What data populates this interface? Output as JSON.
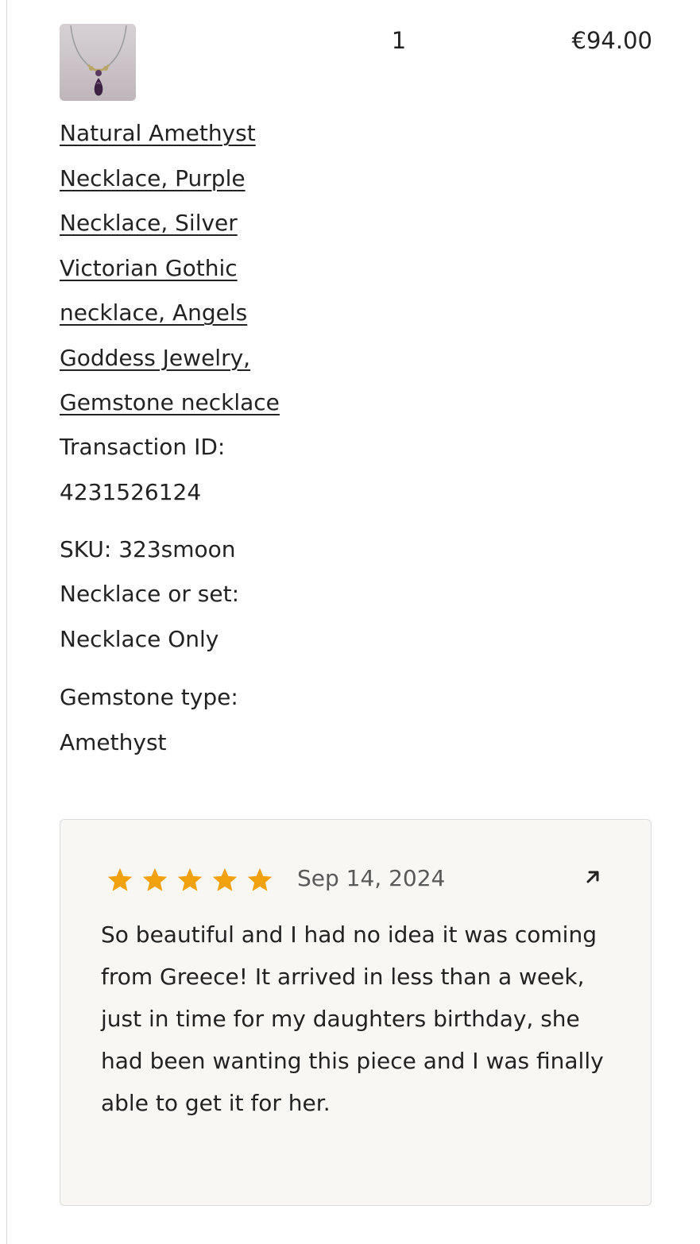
{
  "order_item": {
    "thumbnail_icon": "necklace-photo",
    "quantity": "1",
    "price": "€94.00",
    "title": "Natural Amethyst Necklace, Purple Necklace, Silver Victorian Gothic necklace, Angels Goddess Jewelry, Gemstone necklace",
    "transaction_id_label": "Transaction ID:",
    "transaction_id": "4231526124",
    "sku": "SKU: 323smoon",
    "necklace_or_set_label": "Necklace or set:",
    "necklace_or_set_value": "Necklace Only",
    "gemstone_type_label": "Gemstone type:",
    "gemstone_type_value": "Amethyst"
  },
  "review": {
    "rating": 5,
    "max_rating": 5,
    "star_color": "#f1a10d",
    "date": "Sep 14, 2024",
    "open_icon": "arrow-up-right-icon",
    "text": "So beautiful and I had no idea it was coming from Greece! It arrived in less than a week, just in time for my daughters birthday, she had been wanting this piece and I was finally able to get it for her."
  }
}
